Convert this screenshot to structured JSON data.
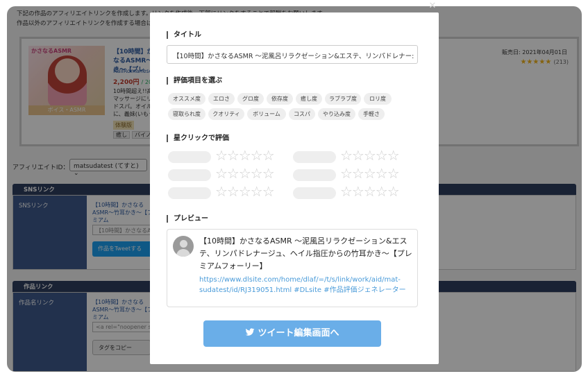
{
  "background": {
    "intro_line1": "下記の作品のアフィリエイトリンクを作成します。リンクを作成後、下部にリンクをすることで報酬をお願いします",
    "intro_line2": "作品以外のアフィリエイトリンクを作成する場合は",
    "product": {
      "thumb_logo": "かさなるASMR",
      "thumb_caption": "ボイス・ASMR",
      "title": "【10時間】かさなるASMR〜かき〜【プレ",
      "circle": "RailRomanesque",
      "price": "2,200円",
      "points": "/ 200p",
      "desc": "10時間超え!!高級マッサージにリンドスパ。オイルに、義妹(いもう",
      "trial_tag": "体験版",
      "tags": [
        "癒し",
        "バイノーラ"
      ],
      "sale_date": "販売日: 2021年04月01日",
      "rating_stars": "★★★★★",
      "rating_count": "(213)",
      "right_frag1": "く",
      "right_frag2": "(",
      "right_frag3": "癒"
    },
    "affiliate_label": "アフィリエイトID：",
    "affiliate_value": "matsudatest (てすと) ⌄",
    "sns": {
      "head": "SNSリンク",
      "side": "SNSリンク",
      "link": "【10時間】かさなるASMR〜竹耳かき〜【プレミアム",
      "input": "【10時間】かさなるASM",
      "button": "作品をTweetする"
    },
    "work": {
      "head": "作品リンク",
      "side": "作品名リンク",
      "link": "【10時間】かさなるASMR〜竹耳かき〜【プレミアム",
      "input": "<a rel=\"noopener sp",
      "button": "タグをコピー"
    }
  },
  "modal": {
    "close_glyph": "✕",
    "title_label": "タイトル",
    "title_value": "【10時間】かさなるASMR 〜泥風呂リラクゼーション&エステ、リンパドレナー:",
    "eval_label": "評価項目を選ぶ",
    "chips_row1": [
      "オススメ度",
      "エロさ",
      "グロ度",
      "依存度",
      "癒し度",
      "ラブラブ度",
      "ロリ度"
    ],
    "chips_row2": [
      "寝取られ度",
      "クオリティ",
      "ボリューム",
      "コスパ",
      "やり込み度",
      "手軽さ"
    ],
    "stars_label": "星クリックで評価",
    "star_glyphs": "☆☆☆☆☆",
    "preview_label": "プレビュー",
    "preview_text": "【10時間】かさなるASMR 〜泥風呂リラクゼーション&エステ、リンパドレナージュ、ヘイル指圧からの竹耳かき〜【プレミアムフォーリー】",
    "preview_link": "https://www.dlsite.com/home/dlaf/=/t/s/link/work/aid/mat-sudatest/id/RJ319051.html #DLsite #作品評価ジェネレーター",
    "tweet_button": "ツイート編集画面へ"
  },
  "colors": {
    "tweet_button": "#6aaee8",
    "link": "#4a9bd9",
    "chip_bg": "#eeeeee",
    "star": "#cfcfcf"
  }
}
